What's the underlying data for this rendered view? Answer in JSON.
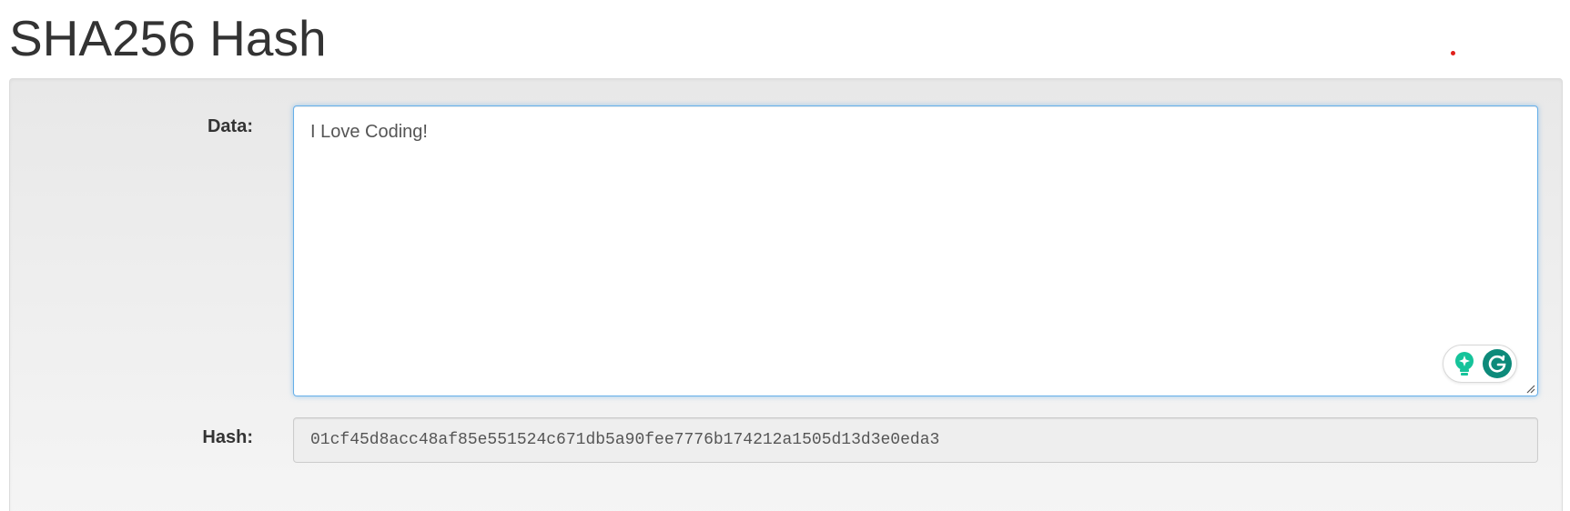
{
  "page": {
    "title": "SHA256 Hash"
  },
  "form": {
    "data_label": "Data:",
    "data_value": "I Love Coding!",
    "hash_label": "Hash:",
    "hash_value": "01cf45d8acc48af85e551524c671db5a90fee7776b174212a1505d13d3e0eda3"
  },
  "icons": {
    "grammarly_suggestions": "lightbulb-icon",
    "grammarly": "grammarly-icon",
    "resize": "resize-handle-icon"
  },
  "colors": {
    "focus_border": "#66afe9",
    "grammarly_green": "#15c39a",
    "grammarly_dark": "#0d8a7a",
    "indicator_red": "#e0201b"
  }
}
